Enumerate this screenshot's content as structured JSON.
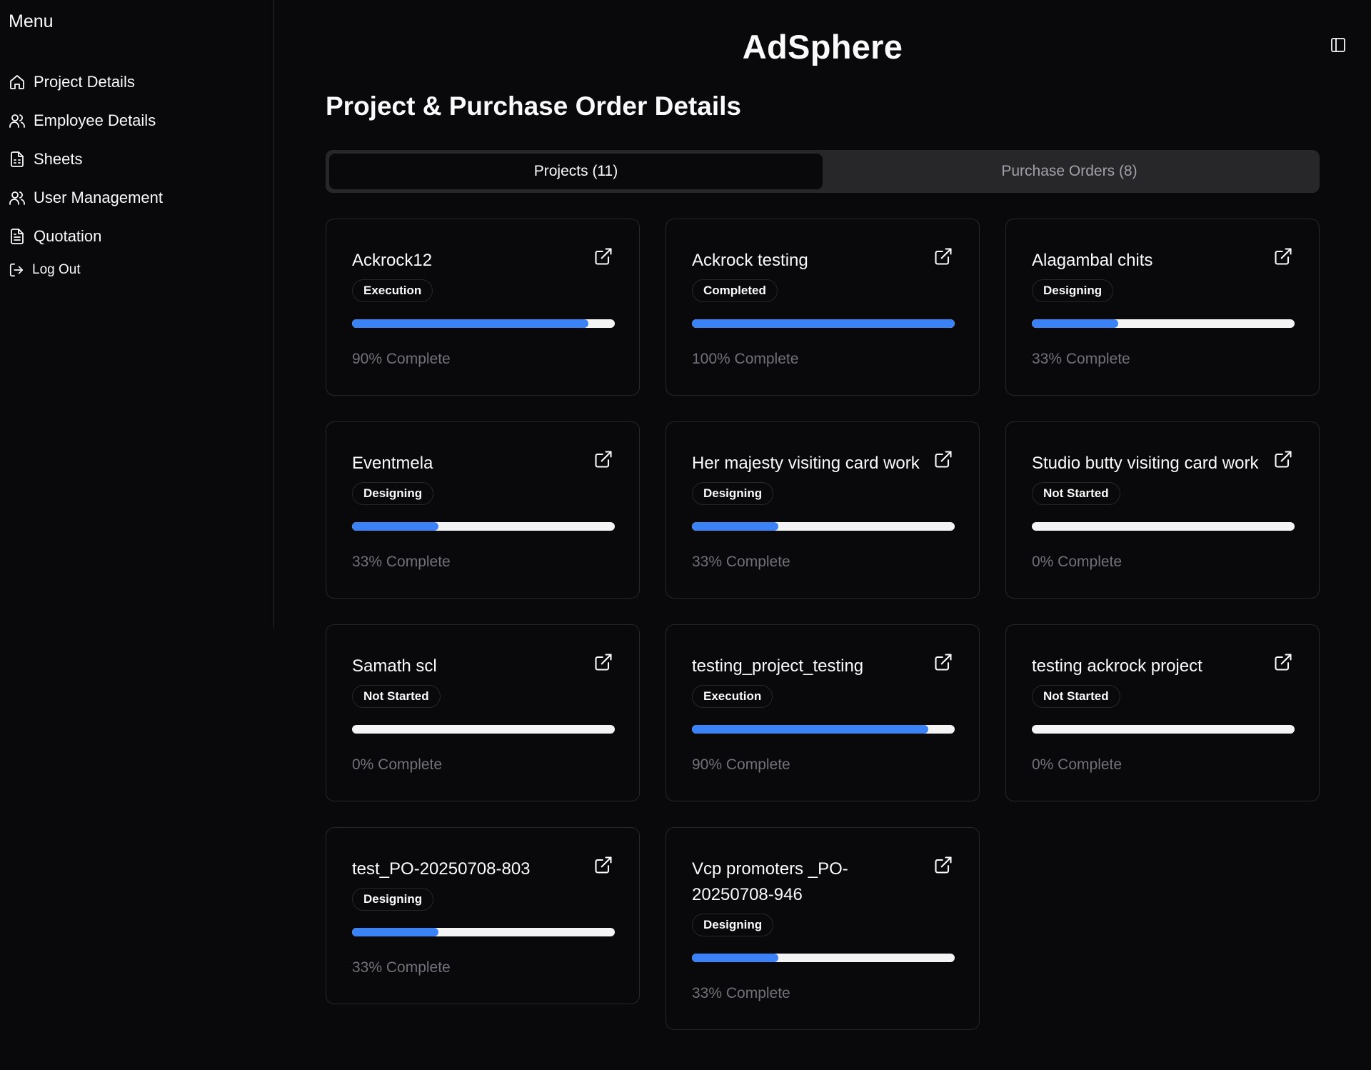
{
  "sidebar": {
    "title": "Menu",
    "items": [
      {
        "label": "Project Details",
        "icon": "home-icon"
      },
      {
        "label": "Employee Details",
        "icon": "users-icon"
      },
      {
        "label": "Sheets",
        "icon": "sheet-icon"
      },
      {
        "label": "User Management",
        "icon": "users-icon"
      },
      {
        "label": "Quotation",
        "icon": "document-icon"
      },
      {
        "label": "Log Out",
        "icon": "logout-icon"
      }
    ]
  },
  "header": {
    "app_title": "AdSphere",
    "toggle_icon": "sidebar-toggle-icon"
  },
  "main": {
    "heading": "Project & Purchase Order Details",
    "tabs": [
      {
        "label": "Projects (11)",
        "active": true
      },
      {
        "label": "Purchase Orders (8)",
        "active": false
      }
    ],
    "projects": [
      {
        "name": "Ackrock12",
        "status": "Execution",
        "progress": 90,
        "progress_text": "90% Complete"
      },
      {
        "name": "Ackrock testing",
        "status": "Completed",
        "progress": 100,
        "progress_text": "100% Complete"
      },
      {
        "name": "Alagambal chits",
        "status": "Designing",
        "progress": 33,
        "progress_text": "33% Complete"
      },
      {
        "name": "Eventmela",
        "status": "Designing",
        "progress": 33,
        "progress_text": "33% Complete"
      },
      {
        "name": "Her majesty visiting card work",
        "status": "Designing",
        "progress": 33,
        "progress_text": "33% Complete"
      },
      {
        "name": "Studio butty visiting card work",
        "status": "Not Started",
        "progress": 0,
        "progress_text": "0% Complete"
      },
      {
        "name": "Samath scl",
        "status": "Not Started",
        "progress": 0,
        "progress_text": "0% Complete"
      },
      {
        "name": "testing_project_testing",
        "status": "Execution",
        "progress": 90,
        "progress_text": "90% Complete"
      },
      {
        "name": "testing ackrock project",
        "status": "Not Started",
        "progress": 0,
        "progress_text": "0% Complete"
      },
      {
        "name": "test_PO-20250708-803",
        "status": "Designing",
        "progress": 33,
        "progress_text": "33% Complete"
      },
      {
        "name": "Vcp promoters _PO-20250708-946",
        "status": "Designing",
        "progress": 33,
        "progress_text": "33% Complete"
      }
    ]
  },
  "colors": {
    "background": "#09090b",
    "border": "#27272a",
    "accent": "#3b82f6",
    "track": "#f4f4f5",
    "muted_text": "#71717a"
  }
}
